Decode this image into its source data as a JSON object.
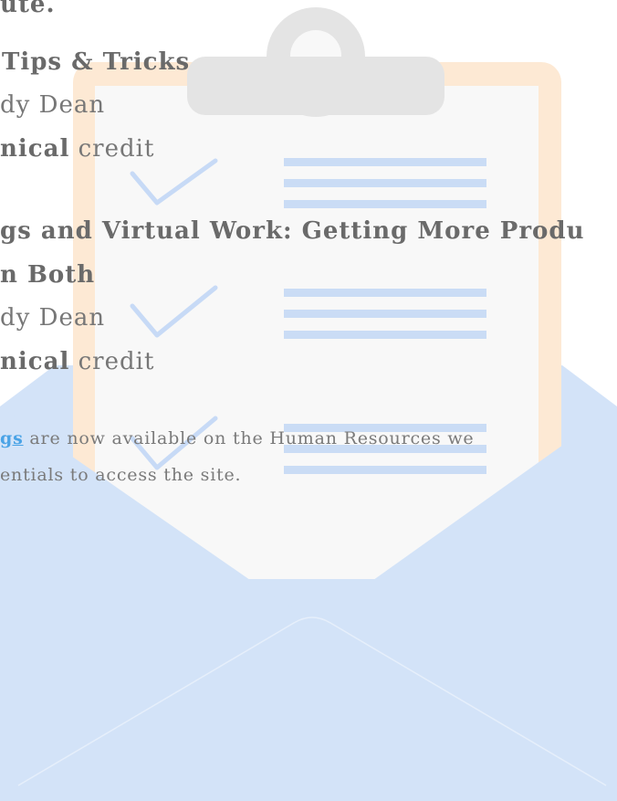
{
  "page": {
    "top_fragment": "ute.",
    "items": [
      {
        "title_lines": [
          "Tips & Tricks"
        ],
        "presenter": "dy Dean",
        "credit_bold": "nical",
        "credit_rest": " credit"
      },
      {
        "title_lines": [
          "gs and Virtual Work: Getting More Produ",
          "n Both"
        ],
        "presenter": "dy Dean",
        "credit_bold": "nical",
        "credit_rest": " credit"
      }
    ],
    "notice": {
      "link_text": "gs",
      "line1_rest": " are now available on the Human Resources we",
      "line2": "entials to access the site."
    }
  },
  "colors": {
    "envelope": "#d3e3f8",
    "clipboard_frame": "#fde9d4",
    "paper": "#f8f8f8",
    "clip": "#e4e4e4",
    "check": "#c7daf6",
    "lines": "#cadcf5",
    "link": "#4aa3e6"
  }
}
